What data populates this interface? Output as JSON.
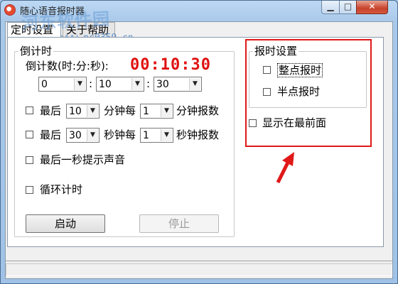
{
  "window": {
    "title": "随心语音报时器"
  },
  "watermark": {
    "brand": "河东软件园",
    "url": "www.pc0359.cn"
  },
  "tabs": [
    {
      "label": "定时设置",
      "active": true
    },
    {
      "label": "关于帮助",
      "active": false
    }
  ],
  "countdown": {
    "group_label": "倒计时",
    "time_label": "倒计数(时:分:秒):",
    "display": "00:10:30",
    "hours": "0",
    "minutes": "10",
    "seconds": "30",
    "separator": ":"
  },
  "options": {
    "last_minutes": {
      "prefix": "最后",
      "value": "10",
      "middle": "分钟每",
      "interval": "1",
      "suffix": "分钟报数",
      "checked": false
    },
    "last_seconds": {
      "prefix": "最后",
      "value": "30",
      "middle": "秒钟每",
      "interval": "1",
      "suffix": "秒钟报数",
      "checked": false
    },
    "last_second_sound": {
      "label": "最后一秒提示声音",
      "checked": false
    },
    "loop_timer": {
      "label": "循环计时",
      "checked": false
    }
  },
  "buttons": {
    "start": "启动",
    "stop": "停止"
  },
  "announce": {
    "group_label": "报时设置",
    "on_hour": "整点报时",
    "half_hour": "半点报时",
    "always_on_top": "显示在最前面"
  },
  "colors": {
    "countdown": "#e01010",
    "highlight": "#e01818"
  }
}
